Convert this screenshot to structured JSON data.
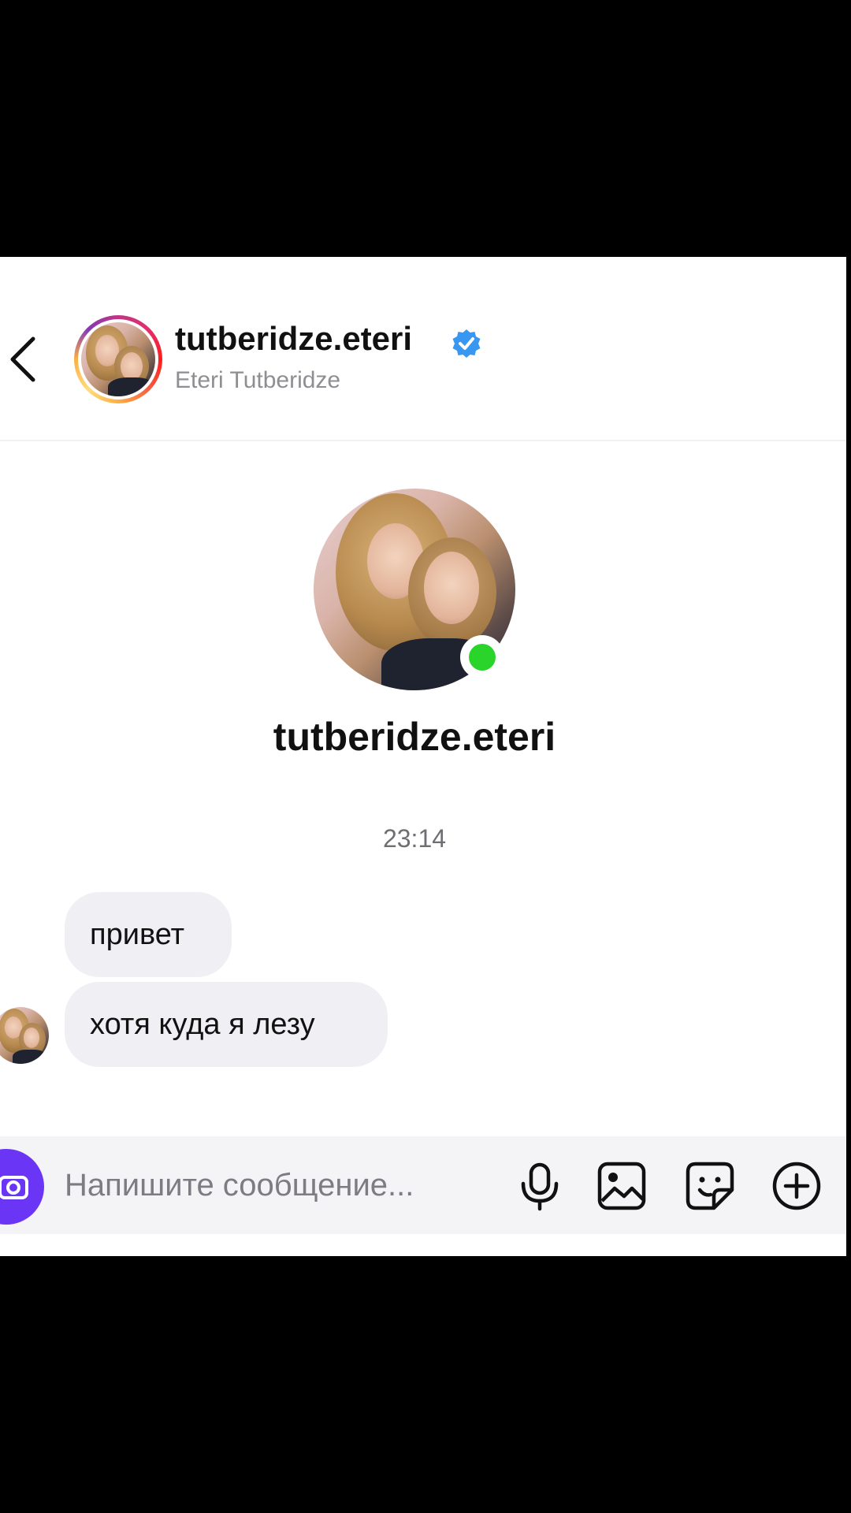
{
  "header": {
    "username": "tutberidze.eteri",
    "full_name": "Eteri Tutberidze",
    "verified": true
  },
  "profile": {
    "username": "tutberidze.eteri",
    "online": true
  },
  "conversation": {
    "timestamp": "23:14",
    "messages": [
      {
        "text": "привет"
      },
      {
        "text": "хотя куда я лезу"
      }
    ]
  },
  "composer": {
    "placeholder": "Напишите сообщение..."
  },
  "icons": {
    "back": "chevron-left-icon",
    "verified": "verified-badge-icon",
    "camera": "camera-icon",
    "mic": "microphone-icon",
    "gallery": "image-icon",
    "sticker": "sticker-icon",
    "add": "plus-circle-icon"
  },
  "colors": {
    "accent": "#6a35f5",
    "verified_blue": "#3897f0",
    "online_green": "#2ad42a",
    "bubble_bg": "#efeff4",
    "composer_bg": "#f4f4f6"
  }
}
